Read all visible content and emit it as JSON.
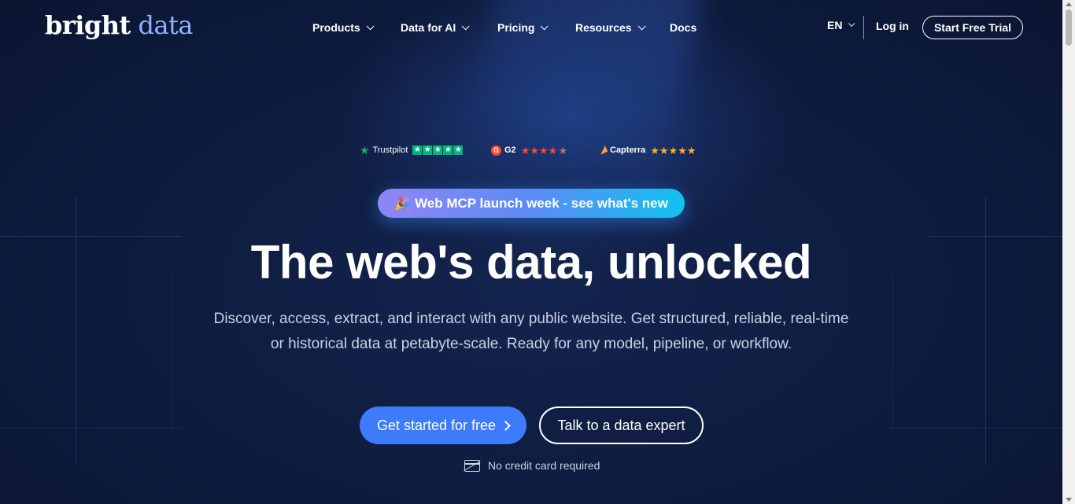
{
  "header": {
    "logo_part1": "bright",
    "logo_part2": "data",
    "nav": [
      {
        "label": "Products",
        "dropdown": true
      },
      {
        "label": "Data for AI",
        "dropdown": true
      },
      {
        "label": "Pricing",
        "dropdown": true
      },
      {
        "label": "Resources",
        "dropdown": true
      },
      {
        "label": "Docs",
        "dropdown": false
      }
    ],
    "language": "EN",
    "login": "Log in",
    "trial": "Start Free Trial"
  },
  "ratings": {
    "trustpilot": {
      "label": "Trustpilot",
      "stars": 5,
      "icon": "trustpilot-star-icon"
    },
    "g2": {
      "label": "G2",
      "stars": 4.5,
      "icon": "g2-logo-icon"
    },
    "capterra": {
      "label": "Capterra",
      "stars": 5,
      "icon": "capterra-logo-icon"
    }
  },
  "announcement": {
    "icon": "party-popper-icon",
    "label": "Web MCP launch week - see what's new"
  },
  "hero": {
    "headline": "The web's data, unlocked",
    "subtitle_line1": "Discover, access, extract, and interact with any public website. Get structured, reliable, real-time",
    "subtitle_line2": "or historical data at petabyte-scale. Ready for any model, pipeline, or workflow."
  },
  "cta": {
    "primary": "Get started for free",
    "secondary": "Talk to a data expert",
    "note": "No credit card required"
  },
  "colors": {
    "background": "#0e1b3d",
    "primary_button": "#3d7bfa",
    "trustpilot_green": "#00b67a",
    "g2_red": "#ff492c",
    "capterra_orange": "#ff9d28"
  }
}
